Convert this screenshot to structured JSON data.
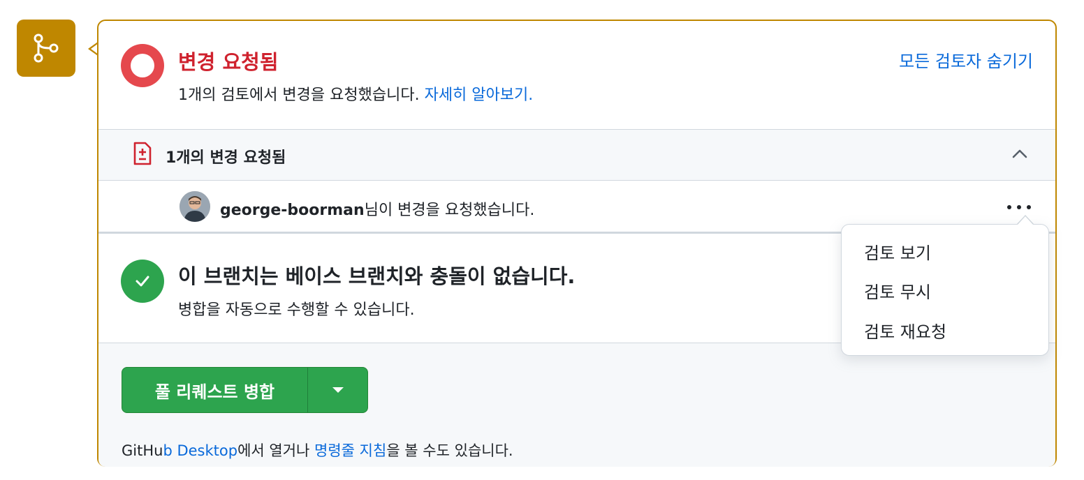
{
  "status": {
    "title": "변경 요청됨",
    "description": "1개의 검토에서 변경을 요청했습니다.",
    "learn_more": "자세히 알아보기.",
    "hide_reviewers": "모든 검토자 숨기기",
    "color": "#cf222e"
  },
  "summary": {
    "label": "1개의 변경 요청됨",
    "icon": "file-diff-icon"
  },
  "reviewer": {
    "username": "george-boorman",
    "action": "님이 변경을 요청했습니다."
  },
  "merge_status": {
    "title": "이 브랜치는 베이스 브랜치와 충돌이 없습니다.",
    "description": "병합을 자동으로 수행할 수 있습니다.",
    "color": "#2da44e"
  },
  "actions": {
    "merge_button": "풀 리퀘스트 병합",
    "alt_prefix": "GitHu",
    "alt_link1": "b Desktop",
    "alt_mid": "에서 열거나 ",
    "alt_link2": "명령줄 지침",
    "alt_suffix": "을 볼 수도 있습니다."
  },
  "menu": {
    "items": [
      "검토 보기",
      "검토 무시",
      "검토 재요청"
    ]
  },
  "colors": {
    "accent": "#bf8700",
    "link": "#0969da"
  }
}
